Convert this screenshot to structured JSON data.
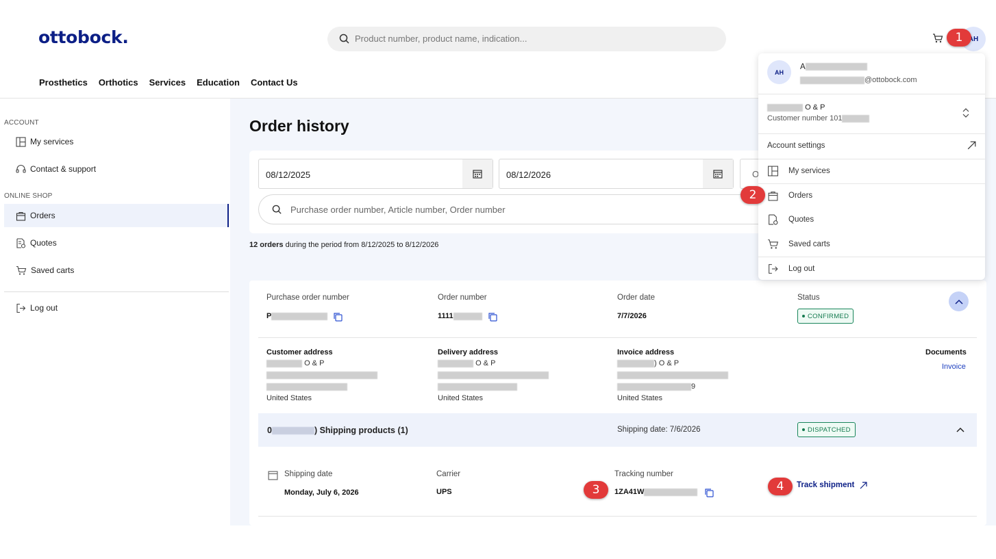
{
  "brand": {
    "logo": "ottobock."
  },
  "header": {
    "search_placeholder": "Product number, product name, indication...",
    "avatar_initials": "AH",
    "nav": [
      "Prosthetics",
      "Orthotics",
      "Services",
      "Education",
      "Contact Us"
    ]
  },
  "sidebar": {
    "account_label": "ACCOUNT",
    "shop_label": "ONLINE SHOP",
    "items": {
      "my_services": "My services",
      "contact_support": "Contact & support",
      "orders": "Orders",
      "quotes": "Quotes",
      "saved_carts": "Saved carts",
      "log_out": "Log out"
    }
  },
  "main": {
    "title": "Order history",
    "date_from": "08/12/2025",
    "date_to": "08/12/2026",
    "third_field_initial": "O",
    "order_search_placeholder": "Purchase order number, Article number, Order number",
    "summary_count": "12 orders",
    "summary_text": "during the period from 8/12/2025 to 8/12/2026"
  },
  "order": {
    "po_label": "Purchase order number",
    "po_value_prefix": "P",
    "order_number_label": "Order number",
    "order_number_prefix": "1111",
    "order_date_label": "Order date",
    "order_date": "7/7/2026",
    "status_label": "Status",
    "status": "CONFIRMED",
    "customer_address_label": "Customer address",
    "delivery_address_label": "Delivery address",
    "invoice_address_label": "Invoice address",
    "address_line1": "O & P",
    "invoice_address_line1": ") O & P",
    "invoice_zip_suffix": "9",
    "country": "United States",
    "documents_label": "Documents",
    "invoice_link": "Invoice",
    "shipment": {
      "prefix": "0",
      "title": ") Shipping products (1)",
      "shipping_date_summary": "Shipping date: 7/6/2026",
      "status": "DISPATCHED",
      "shipping_date_label": "Shipping date",
      "shipping_date": "Monday, July 6, 2026",
      "carrier_label": "Carrier",
      "carrier": "UPS",
      "tracking_label": "Tracking number",
      "tracking_prefix": "1ZA41W",
      "track_link": "Track shipment"
    }
  },
  "dropdown": {
    "avatar_initials": "AH",
    "name_initial": "A",
    "email_suffix": "@ottobock.com",
    "company_suffix": "O & P",
    "customer_number_label": "Customer number 101",
    "account_settings": "Account settings",
    "my_services": "My services",
    "orders": "Orders",
    "quotes": "Quotes",
    "saved_carts": "Saved carts",
    "log_out": "Log out"
  },
  "markers": [
    "1",
    "2",
    "3",
    "4"
  ],
  "colors": {
    "brand": "#0c1f86",
    "status_green": "#147a4f",
    "marker_red": "#e23a3a",
    "active_bg": "#eef2fb"
  }
}
